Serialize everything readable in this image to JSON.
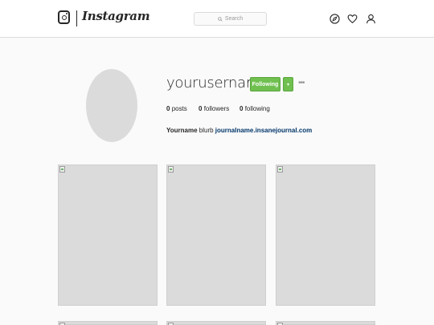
{
  "header": {
    "logo_text": "Instagram",
    "search_placeholder": "Search"
  },
  "profile": {
    "username": "yourusername",
    "follow_label": "Following",
    "dropdown_glyph": "▾",
    "more_glyph": "•••",
    "posts_count": "0",
    "posts_label": "posts",
    "followers_count": "0",
    "followers_label": "followers",
    "following_count": "0",
    "following_label": "following",
    "bio_name": "Yourname",
    "bio_text": "blurb",
    "bio_link": "journalname.insanejournal.com"
  },
  "colors": {
    "follow_green": "#70c050",
    "link_blue": "#003569",
    "placeholder_gray": "#dbdbdb"
  }
}
